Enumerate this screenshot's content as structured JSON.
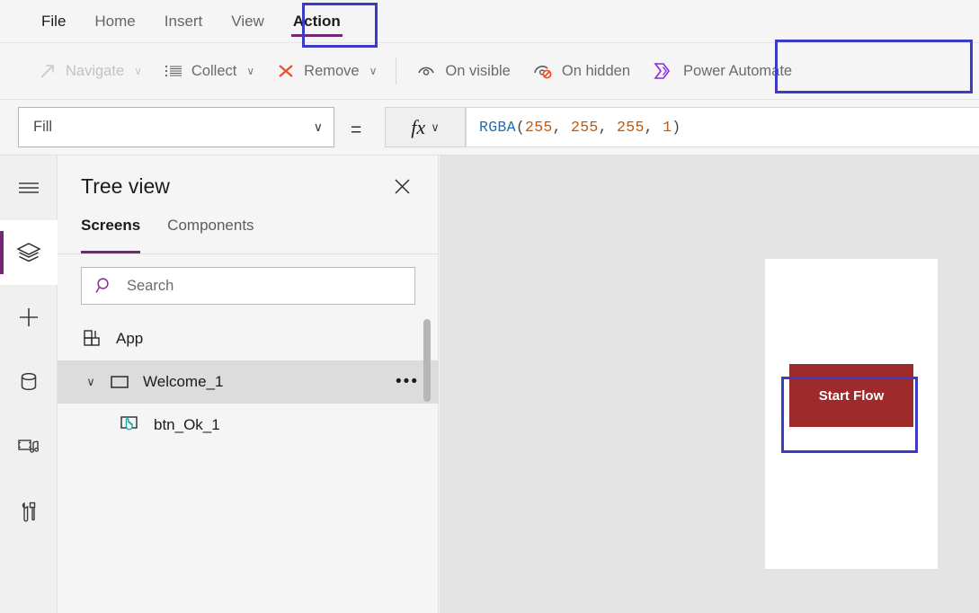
{
  "menubar": {
    "items": [
      {
        "label": "File",
        "icon": "file-menu",
        "active": false
      },
      {
        "label": "Home",
        "icon": "home-menu",
        "active": false
      },
      {
        "label": "Insert",
        "icon": "insert-menu",
        "active": false
      },
      {
        "label": "View",
        "icon": "view-menu",
        "active": false
      },
      {
        "label": "Action",
        "icon": "action-menu",
        "active": true
      }
    ]
  },
  "commandbar": {
    "items": [
      {
        "label": "Navigate",
        "icon": "arrow-up-right-icon",
        "chevron": "∨",
        "disabled": true
      },
      {
        "label": "Collect",
        "icon": "bulleted-list-icon",
        "chevron": "∨",
        "disabled": false
      },
      {
        "label": "Remove",
        "icon": "x-red-icon",
        "chevron": "∨",
        "disabled": false
      },
      {
        "label": "On visible",
        "icon": "eye-icon",
        "chevron": "",
        "disabled": false
      },
      {
        "label": "On hidden",
        "icon": "eye-hidden-icon",
        "chevron": "",
        "disabled": false
      },
      {
        "label": "Power Automate",
        "icon": "power-automate-icon",
        "chevron": "",
        "disabled": false
      }
    ]
  },
  "formulabar": {
    "property": "Fill",
    "property_chevron": "∨",
    "equals": "=",
    "fx_label": "fx",
    "fx_chevron": "∨",
    "formula": {
      "function_name": "RGBA",
      "open_paren": "(",
      "args": [
        "255",
        "255",
        "255",
        "1"
      ],
      "separator": ", ",
      "close_paren": ")",
      "full_text": "RGBA(255, 255, 255, 1)"
    }
  },
  "rail": {
    "items": [
      {
        "name": "hamburger-menu-icon",
        "active": false
      },
      {
        "name": "tree-view-layers-icon",
        "active": true
      },
      {
        "name": "insert-plus-icon",
        "active": false
      },
      {
        "name": "data-cylinder-icon",
        "active": false
      },
      {
        "name": "media-icon",
        "active": false
      },
      {
        "name": "advanced-tools-icon",
        "active": false
      }
    ]
  },
  "treeview": {
    "title": "Tree view",
    "close_icon": "✕",
    "tabs": [
      {
        "label": "Screens",
        "active": true
      },
      {
        "label": "Components",
        "active": false
      }
    ],
    "search": {
      "placeholder": "Search",
      "value": "",
      "icon": "search-icon"
    },
    "nodes": [
      {
        "label": "App",
        "icon": "app-grid-icon",
        "indent": 0,
        "expander": "",
        "selected": false,
        "more": ""
      },
      {
        "label": "Welcome_1",
        "icon": "screen-rect-icon",
        "indent": 0,
        "expander": "∨",
        "selected": true,
        "more": "•••"
      },
      {
        "label": "btn_Ok_1",
        "icon": "button-control-icon",
        "indent": 1,
        "expander": "",
        "selected": false,
        "more": ""
      }
    ]
  },
  "canvas": {
    "screen_name": "Welcome_1",
    "controls": [
      {
        "label": "Start Flow",
        "type": "button",
        "fill": "#9e2a2b",
        "color": "#ffffff",
        "selected": true
      }
    ]
  },
  "annotations": [
    {
      "name": "action-tab-highlight",
      "color": "#3b3bc4"
    },
    {
      "name": "power-automate-highlight",
      "color": "#3b3bc4"
    },
    {
      "name": "start-flow-button-highlight",
      "color": "#3b3bc4"
    }
  ],
  "colors": {
    "brand_purple": "#742774",
    "annotation_blue": "#3b3bc4",
    "button_red": "#9e2a2b",
    "formula_function": "#1f6fb8",
    "formula_number": "#c2590a",
    "teal_accent": "#19a3a3"
  }
}
